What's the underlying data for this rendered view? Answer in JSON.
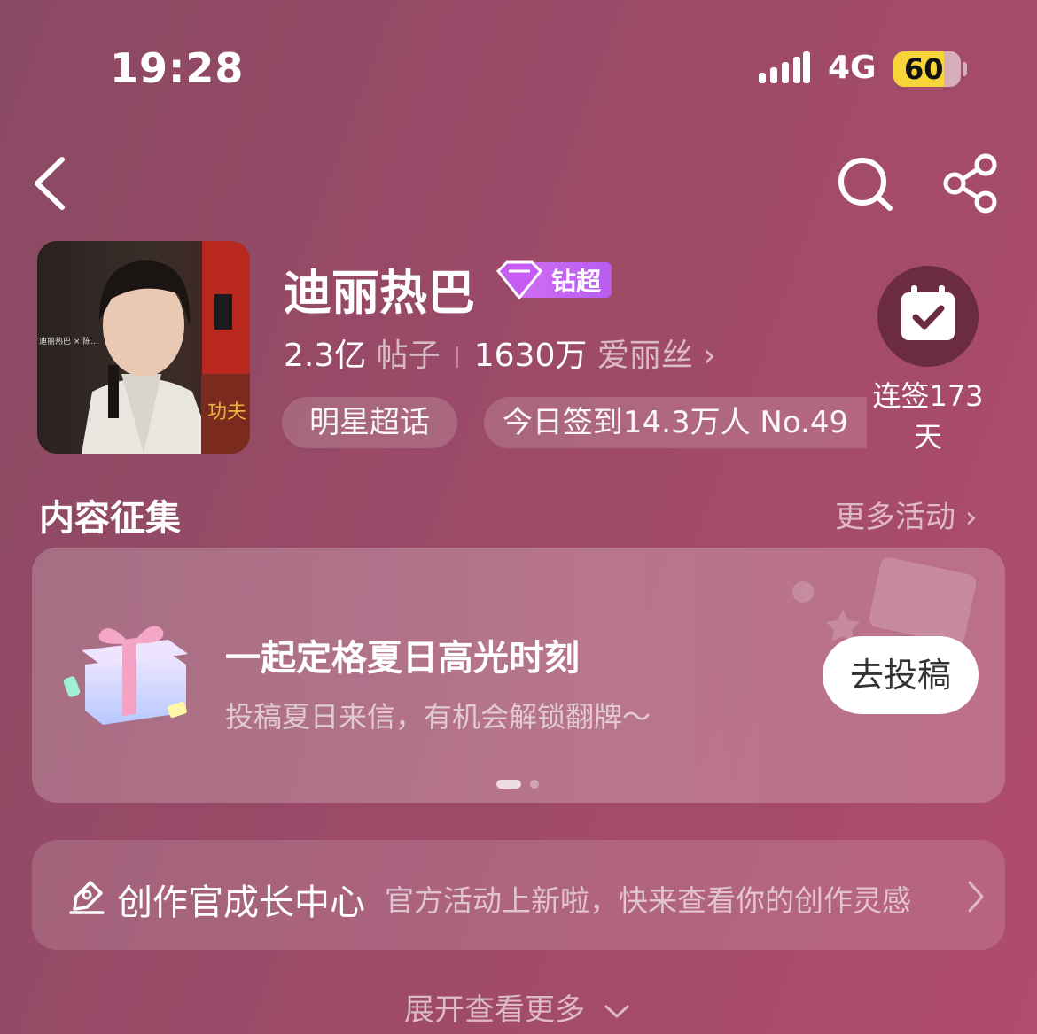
{
  "status_bar": {
    "time": "19:28",
    "network": "4G",
    "battery": "60"
  },
  "nav": {
    "back_icon": "chevron-left-icon",
    "search_icon": "search-icon",
    "share_icon": "share-icon"
  },
  "profile": {
    "name": "迪丽热巴",
    "badge": "钻超",
    "posts_count": "2.3亿",
    "posts_label": "帖子",
    "fans_count": "1630万",
    "fans_label": "爱丽丝",
    "tag_category": "明星超话",
    "tag_checkin": "今日签到14.3万人 No.49",
    "avatar_text": "迪丽热巴 × 陈…"
  },
  "checkin": {
    "label": "连签173天",
    "icon": "calendar-check-icon"
  },
  "section": {
    "title": "内容征集",
    "more": "更多活动"
  },
  "card": {
    "title": "一起定格夏日高光时刻",
    "subtitle": "投稿夏日来信，有机会解锁翻牌～",
    "button": "去投稿",
    "icon": "gift-box-icon"
  },
  "creator": {
    "title": "创作官成长中心",
    "subtitle": "官方活动上新啦，快来查看你的创作灵感",
    "icon": "creator-pen-icon"
  },
  "footer": {
    "expand": "展开查看更多"
  },
  "colors": {
    "badge": "#c56bf2",
    "battery": "#f7d53a",
    "checkin_circle": "#6b2c43"
  }
}
